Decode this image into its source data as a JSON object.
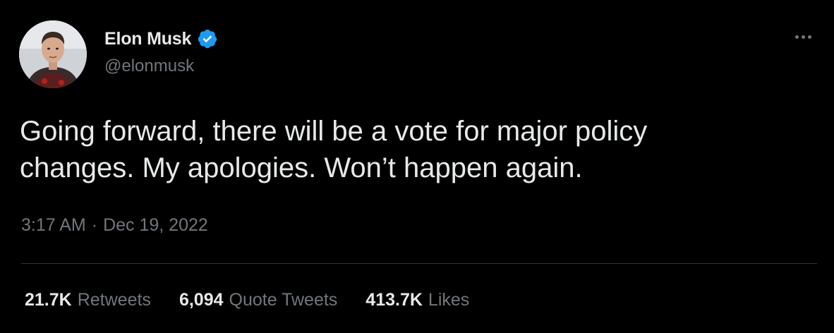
{
  "author": {
    "display_name": "Elon Musk",
    "handle": "@elonmusk",
    "verified": true,
    "avatar_icon": "profile-photo"
  },
  "tweet": {
    "text": "Going forward, there will be a vote for major policy\nchanges. My apologies. Won’t happen again.",
    "time": "3:17 AM",
    "separator": "·",
    "date": "Dec 19, 2022"
  },
  "stats": {
    "retweets_count": "21.7K",
    "retweets_label": "Retweets",
    "quote_tweets_count": "6,094",
    "quote_tweets_label": "Quote Tweets",
    "likes_count": "413.7K",
    "likes_label": "Likes"
  },
  "colors": {
    "background": "#000000",
    "text_primary": "#e7e9ea",
    "text_secondary": "#71767b",
    "verified": "#1d9bf0",
    "divider": "#2f3336"
  },
  "icons": {
    "more": "more-dots-icon",
    "verified": "verified-badge-icon"
  }
}
